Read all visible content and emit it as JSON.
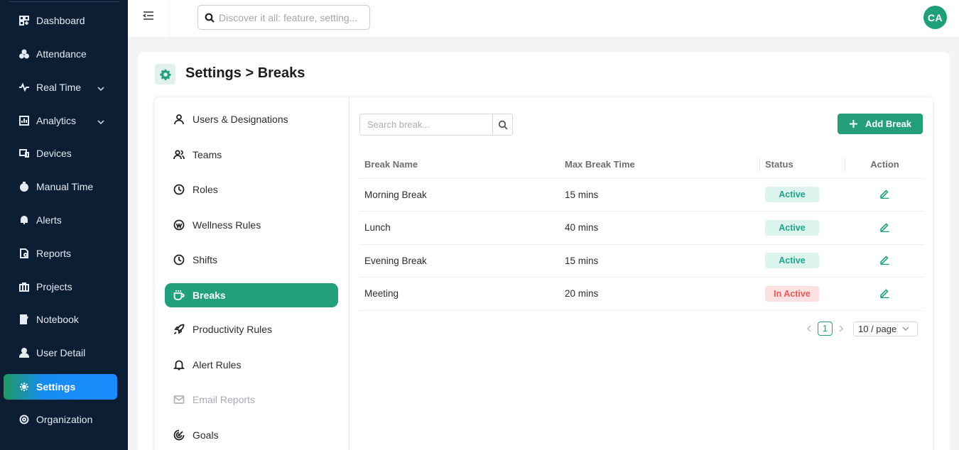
{
  "sidebar": {
    "items": [
      {
        "label": "Dashboard",
        "icon": "dashboard-icon"
      },
      {
        "label": "Attendance",
        "icon": "attendance-icon"
      },
      {
        "label": "Real Time",
        "icon": "pulse-icon",
        "chevron": true
      },
      {
        "label": "Analytics",
        "icon": "analytics-icon",
        "chevron": true
      },
      {
        "label": "Devices",
        "icon": "devices-icon"
      },
      {
        "label": "Manual Time",
        "icon": "stopwatch-icon"
      },
      {
        "label": "Alerts",
        "icon": "bell-icon"
      },
      {
        "label": "Reports",
        "icon": "reports-icon"
      },
      {
        "label": "Projects",
        "icon": "briefcase-icon"
      },
      {
        "label": "Notebook",
        "icon": "notebook-icon"
      },
      {
        "label": "User Detail",
        "icon": "user-icon"
      },
      {
        "label": "Settings",
        "icon": "gear-icon",
        "active": true
      },
      {
        "label": "Organization",
        "icon": "organization-icon"
      }
    ]
  },
  "topbar": {
    "search_placeholder": "Discover it all: feature, setting...",
    "avatar_initials": "CA"
  },
  "page": {
    "title": "Settings > Breaks"
  },
  "settings_menu": {
    "items": [
      {
        "label": "Users & Designations"
      },
      {
        "label": "Teams"
      },
      {
        "label": "Roles"
      },
      {
        "label": "Wellness Rules"
      },
      {
        "label": "Shifts"
      },
      {
        "label": "Breaks",
        "active": true
      },
      {
        "label": "Productivity Rules"
      },
      {
        "label": "Alert Rules"
      },
      {
        "label": "Email Reports",
        "disabled": true
      },
      {
        "label": "Goals"
      }
    ]
  },
  "breaks": {
    "search_placeholder": "Search break...",
    "add_label": "Add Break",
    "columns": [
      "Break Name",
      "Max Break Time",
      "Status",
      "Action"
    ],
    "rows": [
      {
        "name": "Morning Break",
        "max_time": "15 mins",
        "status": "Active"
      },
      {
        "name": "Lunch",
        "max_time": "40 mins",
        "status": "Active"
      },
      {
        "name": "Evening Break",
        "max_time": "15 mins",
        "status": "Active"
      },
      {
        "name": "Meeting",
        "max_time": "20 mins",
        "status": "In Active"
      }
    ],
    "pagination": {
      "current_page": "1",
      "page_size": "10 / page"
    }
  },
  "colors": {
    "accent": "#23a07b",
    "sidebar_bg": "#0b1e33",
    "active_status_bg": "#dcf3ee",
    "inactive_status_bg": "#fde0e0"
  }
}
